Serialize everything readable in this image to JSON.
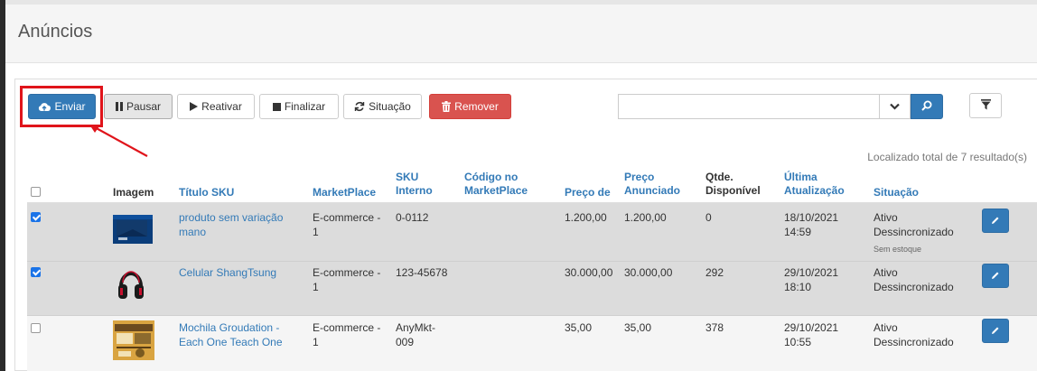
{
  "page": {
    "title": "Anúncios"
  },
  "toolbar": {
    "send_label": "Enviar",
    "pause_label": "Pausar",
    "reactivate_label": "Reativar",
    "finish_label": "Finalizar",
    "status_label": "Situação",
    "remove_label": "Remover"
  },
  "search": {
    "value": "",
    "placeholder": ""
  },
  "results": {
    "total_text": "Localizado total de 7 resultado(s)"
  },
  "table": {
    "headers": {
      "image": "Imagem",
      "title_sku": "Título SKU",
      "marketplace": "MarketPlace",
      "sku_interno_1": "SKU",
      "sku_interno_2": "Interno",
      "codigo_1": "Código no",
      "codigo_2": "MarketPlace",
      "preco_de": "Preço de",
      "preco_anunciado_1": "Preço",
      "preco_anunciado_2": "Anunciado",
      "qtde_1": "Qtde.",
      "qtde_2": "Disponível",
      "ultima_1": "Última",
      "ultima_2": "Atualização",
      "situacao": "Situação"
    },
    "rows": [
      {
        "checked": true,
        "title_1": "produto sem variação",
        "title_2": "mano",
        "marketplace_1": "E-commerce -",
        "marketplace_2": "1",
        "sku_1": "0-0112",
        "sku_2": "",
        "codigo": "",
        "preco_de": "1.200,00",
        "preco_anunciado": "1.200,00",
        "qtde": "0",
        "date": "18/10/2021",
        "time": "14:59",
        "status_1": "Ativo",
        "status_2": "Dessincronizado",
        "status_note": "Sem estoque"
      },
      {
        "checked": true,
        "title_1": "Celular ShangTsung",
        "title_2": "",
        "marketplace_1": "E-commerce -",
        "marketplace_2": "1",
        "sku_1": "123-45678",
        "sku_2": "",
        "codigo": "",
        "preco_de": "30.000,00",
        "preco_anunciado": "30.000,00",
        "qtde": "292",
        "date": "29/10/2021",
        "time": "18:10",
        "status_1": "Ativo",
        "status_2": "Dessincronizado",
        "status_note": ""
      },
      {
        "checked": false,
        "title_1": "Mochila Groudation -",
        "title_2": "Each One Teach One",
        "marketplace_1": "E-commerce -",
        "marketplace_2": "1",
        "sku_1": "AnyMkt-",
        "sku_2": "009",
        "codigo": "",
        "preco_de": "35,00",
        "preco_anunciado": "35,00",
        "qtde": "378",
        "date": "29/10/2021",
        "time": "10:55",
        "status_1": "Ativo",
        "status_2": "Dessincronizado",
        "status_note": ""
      }
    ]
  },
  "colors": {
    "primary": "#337ab7",
    "danger": "#d9534f",
    "highlight": "#e0141b",
    "selected_row": "#dcdcdc"
  }
}
